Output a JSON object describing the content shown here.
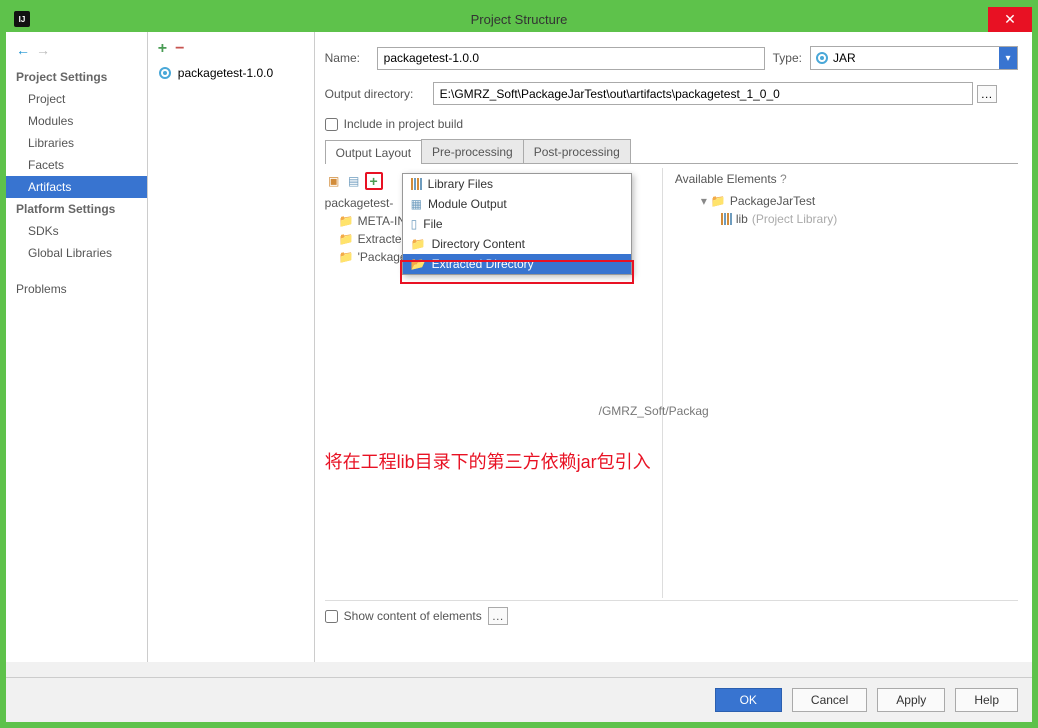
{
  "window": {
    "title": "Project Structure",
    "app_badge": "IJ"
  },
  "left": {
    "section_project": "Project Settings",
    "items_project": [
      "Project",
      "Modules",
      "Libraries",
      "Facets",
      "Artifacts"
    ],
    "section_platform": "Platform Settings",
    "items_platform": [
      "SDKs",
      "Global Libraries"
    ],
    "problems": "Problems"
  },
  "mid": {
    "artifact": "packagetest-1.0.0"
  },
  "form": {
    "name_label": "Name:",
    "name_value": "packagetest-1.0.0",
    "type_label": "Type:",
    "type_value": "JAR",
    "outdir_label": "Output directory:",
    "outdir_value": "E:\\GMRZ_Soft\\PackageJarTest\\out\\artifacts\\packagetest_1_0_0",
    "include_label": "Include in project build"
  },
  "tabs": {
    "t1": "Output Layout",
    "t2": "Pre-processing",
    "t3": "Post-processing"
  },
  "tree": {
    "root": "packagetest-",
    "meta": "META-INF",
    "ext": "Extracted",
    "pkg": "'PackageJ",
    "clipped": "/GMRZ_Soft/Packag"
  },
  "menu": {
    "m1": "Library Files",
    "m2": "Module Output",
    "m3": "File",
    "m4": "Directory Content",
    "m5": "Extracted Directory"
  },
  "avail": {
    "header": "Available Elements",
    "q": "?",
    "proj": "PackageJarTest",
    "lib": "lib",
    "libnote": "(Project Library)"
  },
  "annotation": "将在工程lib目录下的第三方依赖jar包引入",
  "show_label": "Show content of elements",
  "buttons": {
    "ok": "OK",
    "cancel": "Cancel",
    "apply": "Apply",
    "help": "Help"
  }
}
